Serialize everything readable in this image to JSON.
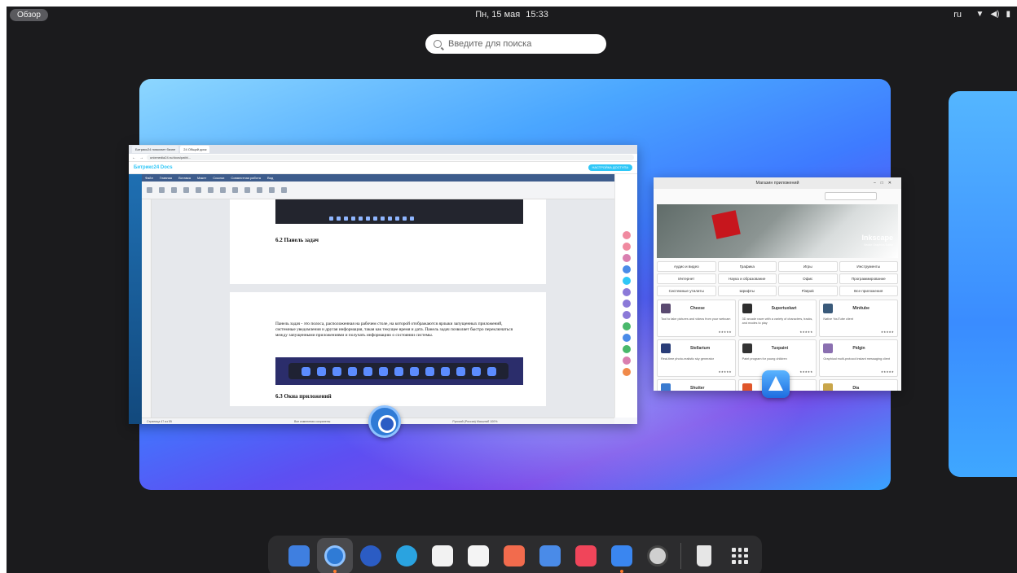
{
  "topbar": {
    "overview_label": "Обзор",
    "clock_day": "Пн, 15 мая",
    "clock_time": "15:33",
    "language": "ru"
  },
  "search": {
    "placeholder": "Введите для поиска"
  },
  "browser": {
    "tabs": [
      "Битрикс24 помогает бизне",
      "24 Общий диск"
    ],
    "url": "unixmedia24.ru/docs/path/...",
    "logo": "Битрикс24 Docs",
    "access_button": "НАСТРОЙКА ДОСТУПА",
    "menu_items": [
      "Файл",
      "Главная",
      "Вставка",
      "Макет",
      "Ссылки",
      "Совместная работа",
      "Вид"
    ],
    "doc": {
      "heading1": "6.2 Панель задач",
      "paragraph": "Панель задач - это полоса, расположенная на рабочем столе, на которой отображаются ярлыки запущенных приложений, системные уведомления и другая информация, такая как текущее время и дата. Панель задач позволяет быстро переключаться между запущенными приложениями и получать информацию о состоянии системы.",
      "heading2": "6.3 Окна приложений"
    },
    "status_left": "Страница 47 из 55",
    "status_mid": "Все изменения сохранены",
    "status_right": "Русский (Россия)  Масштаб 100%"
  },
  "store": {
    "title": "Магазин приложений",
    "banner_title": "Inkscape",
    "banner_subtitle": "Vector Graphics Editor",
    "categories": [
      "Аудио и видео",
      "Графика",
      "Игры",
      "Инструменты",
      "Интернет",
      "Наука и образование",
      "Офис",
      "Программирование",
      "Системные утилиты",
      "Шрифты",
      "Flatpak",
      "Все приложения"
    ],
    "apps": [
      {
        "name": "Cheese",
        "desc": "Tool to take pictures and videos from your webcam",
        "stars": "★★★★★"
      },
      {
        "name": "Supertuxkart",
        "desc": "3D arcade racer with a variety of characters, tracks, and modes to play",
        "stars": "★★★★★"
      },
      {
        "name": "Minitube",
        "desc": "Native YouTube client",
        "stars": "★★★★★"
      },
      {
        "name": "Stellarium",
        "desc": "Real-time photo-realistic sky generator",
        "stars": "★★★★★"
      },
      {
        "name": "Tuxpaint",
        "desc": "Paint program for young children",
        "stars": "★★★★★"
      },
      {
        "name": "Pidgin",
        "desc": "Graphical multi-protocol instant messaging client",
        "stars": "★★★★★"
      },
      {
        "name": "Shutter",
        "desc": "",
        "stars": ""
      },
      {
        "name": "",
        "desc": "",
        "stars": ""
      },
      {
        "name": "Dia",
        "desc": "",
        "stars": ""
      }
    ]
  },
  "dock": {
    "items": [
      {
        "icon": "files-icon",
        "color": "#3f7fe0"
      },
      {
        "icon": "chrome-icon",
        "color": "#2f7bd6"
      },
      {
        "icon": "thunderbird-icon",
        "color": "#2b5cc4"
      },
      {
        "icon": "telegram-icon",
        "color": "#2aa3e0"
      },
      {
        "icon": "photos-icon",
        "color": "#f2f2f2"
      },
      {
        "icon": "notes-icon",
        "color": "#f4f4f4"
      },
      {
        "icon": "calendar-icon",
        "color": "#f26b4d"
      },
      {
        "icon": "image-viewer-icon",
        "color": "#4a8be8"
      },
      {
        "icon": "music-icon",
        "color": "#f0455a"
      },
      {
        "icon": "app-store-icon",
        "color": "#3a86f0"
      },
      {
        "icon": "settings-icon",
        "color": "#cfcfcf"
      }
    ],
    "trash_icon": "trash-icon",
    "apps_grid_icon": "show-apps-icon"
  }
}
